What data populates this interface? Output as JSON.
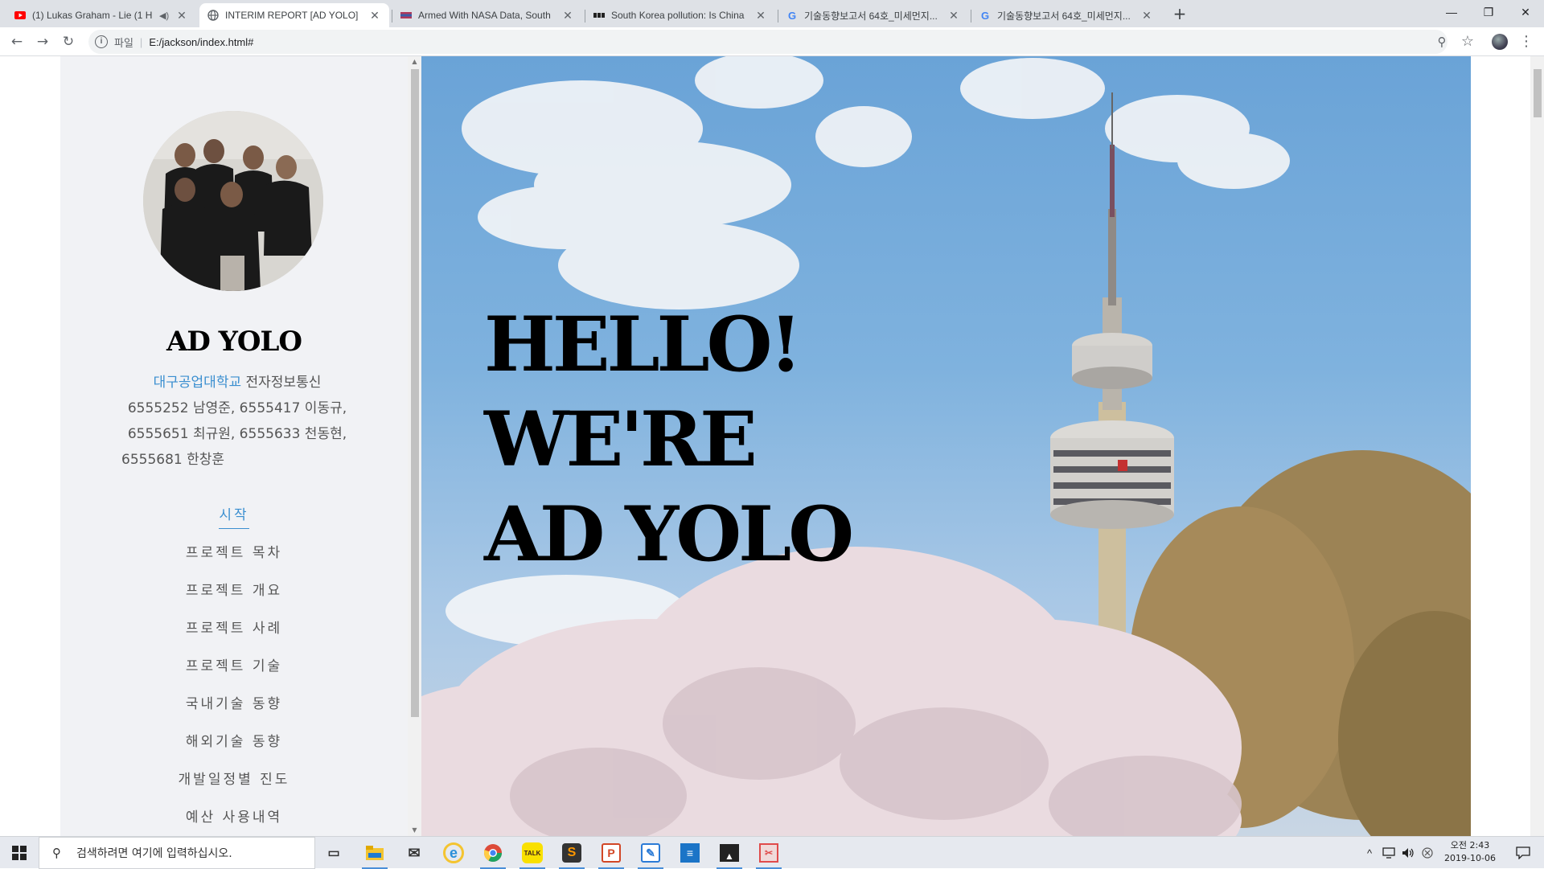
{
  "browser": {
    "tabs": [
      {
        "title": "(1) Lukas Graham - Lie (1 H",
        "favicon": "youtube-icon",
        "close": "✕",
        "mute": "◀)"
      },
      {
        "title": "INTERIM REPORT [AD YOLO]",
        "favicon": "globe-icon",
        "close": "✕"
      },
      {
        "title": "Armed With NASA Data, South",
        "favicon": "site-icon",
        "close": "✕"
      },
      {
        "title": "South Korea pollution: Is China",
        "favicon": "bbc-icon",
        "close": "✕"
      },
      {
        "title": "기술동향보고서 64호_미세먼지...",
        "favicon": "google-icon",
        "close": "✕"
      },
      {
        "title": "기술동향보고서 64호_미세먼지...",
        "favicon": "google-icon",
        "close": "✕"
      }
    ],
    "new_tab": "+",
    "window_controls": {
      "minimize": "—",
      "maximize": "❐",
      "close": "✕"
    },
    "nav": {
      "back": "←",
      "forward": "→",
      "reload": "↻"
    },
    "address": {
      "info": "i",
      "scheme": "파일",
      "separator": "|",
      "url": "E:/jackson/index.html#"
    },
    "toolbar_right": {
      "zoom": "⚲",
      "star": "☆",
      "menu": "⋮"
    }
  },
  "sidebar": {
    "brand": "AD YOLO",
    "school": "대구공업대학교",
    "department": " 전자정보통신",
    "members_line1": "6555252 남영준,  6555417 이동규,",
    "members_line2": "6555651 최규원,  6555633 천동현,",
    "members_line3": "6555681 한창훈",
    "menu": [
      {
        "label": "시작",
        "active": true
      },
      {
        "label": "프로젝트 목차"
      },
      {
        "label": "프로젝트 개요"
      },
      {
        "label": "프로젝트 사례"
      },
      {
        "label": "프로젝트 기술"
      },
      {
        "label": "국내기술 동향"
      },
      {
        "label": "해외기술 동향"
      },
      {
        "label": "개발일정별 진도"
      },
      {
        "label": "예산 사용내역"
      }
    ],
    "scroll_up": "▲",
    "scroll_down": "▼"
  },
  "hero": {
    "line1": "HELLO!",
    "line2": "WE'RE",
    "line3": "AD YOLO"
  },
  "taskbar": {
    "search_placeholder": "검색하려면 여기에 입력하십시오.",
    "search_icon": "⚲",
    "clock_time": "오전 2:43",
    "clock_date": "2019-10-06",
    "tray_up": "^",
    "apps": [
      {
        "name": "task-view-icon",
        "glyph": "▭",
        "color": "transparent"
      },
      {
        "name": "file-explorer-icon",
        "glyph": "",
        "color": "#f4c430"
      },
      {
        "name": "mail-icon",
        "glyph": "✉",
        "color": "transparent"
      },
      {
        "name": "ie-icon",
        "glyph": "e",
        "color": "#2a8fd9"
      },
      {
        "name": "chrome-icon",
        "glyph": "",
        "color": "#dd4b39"
      },
      {
        "name": "kakaotalk-icon",
        "glyph": "TALK",
        "color": "#f9e000"
      },
      {
        "name": "sublime-icon",
        "glyph": "S",
        "color": "#ff9800"
      },
      {
        "name": "powerpoint-icon",
        "glyph": "P",
        "color": "#d24726"
      },
      {
        "name": "editor-icon",
        "glyph": "✎",
        "color": "#2b7bd6"
      },
      {
        "name": "app-icon",
        "glyph": "≡",
        "color": "#1b74c7"
      },
      {
        "name": "photos-icon",
        "glyph": "▲",
        "color": "#222"
      },
      {
        "name": "snipping-icon",
        "glyph": "✂",
        "color": "#e04b4b"
      }
    ],
    "colors": {
      "accent": "#3b8fd0",
      "taskbar": "#e6e9ef"
    }
  }
}
